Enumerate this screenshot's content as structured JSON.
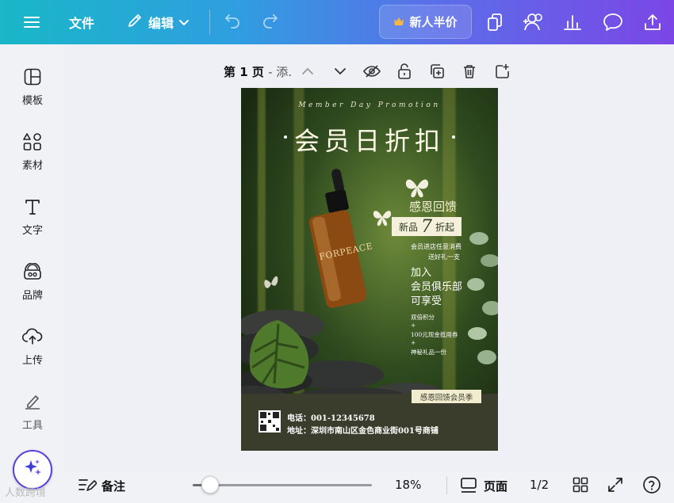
{
  "topbar": {
    "menu_icon": "hamburger-icon",
    "file_label": "文件",
    "edit_label": "编辑",
    "promo_label": "新人半价",
    "icons": [
      "undo-icon",
      "redo-icon",
      "copy-icon",
      "share-people-icon",
      "chart-icon",
      "comment-icon",
      "export-icon"
    ]
  },
  "sidebar": {
    "items": [
      {
        "label": "模板",
        "icon": "template-icon"
      },
      {
        "label": "素材",
        "icon": "elements-icon"
      },
      {
        "label": "文字",
        "icon": "text-icon"
      },
      {
        "label": "品牌",
        "icon": "brand-icon"
      },
      {
        "label": "上传",
        "icon": "upload-icon"
      },
      {
        "label": "工具",
        "icon": "tools-icon"
      }
    ],
    "magic_icon": "sparkle-icon"
  },
  "page_toolbar": {
    "page_label": "第 1 页",
    "page_subtitle": "- 添.",
    "icons": [
      "chevron-up-icon",
      "chevron-down-icon",
      "visibility-icon",
      "lock-icon",
      "duplicate-icon",
      "trash-icon",
      "add-page-icon"
    ]
  },
  "poster": {
    "english_heading": "Member Day Promotion",
    "title": "会员日折扣",
    "thanks": "感恩回馈",
    "new_prefix": "新品",
    "discount_number": "7",
    "discount_suffix": "折起",
    "line1": "会员进店任意消费",
    "line2": "送好礼一支",
    "join1": "加入",
    "join2": "会员俱乐部",
    "join3": "可享受",
    "benefit1": "双倍积分",
    "plus1": "+",
    "benefit2": "100元现金抵用券",
    "plus2": "+",
    "benefit3": "神秘礼品一份",
    "season_tag": "感恩回馈会员季",
    "product_brand": "FORPEACE",
    "phone": "电话：001-12345678",
    "address": "地址：深圳市南山区金色商业街001号商铺"
  },
  "bottombar": {
    "notes_label": "备注",
    "zoom_level": 0.18,
    "zoom_text": "18%",
    "pages_label": "页面",
    "page_count": "1/2",
    "icons": [
      "notes-icon",
      "page-view-icon",
      "grid-view-icon",
      "expand-icon",
      "help-icon"
    ]
  },
  "watermark": "人数跨境"
}
